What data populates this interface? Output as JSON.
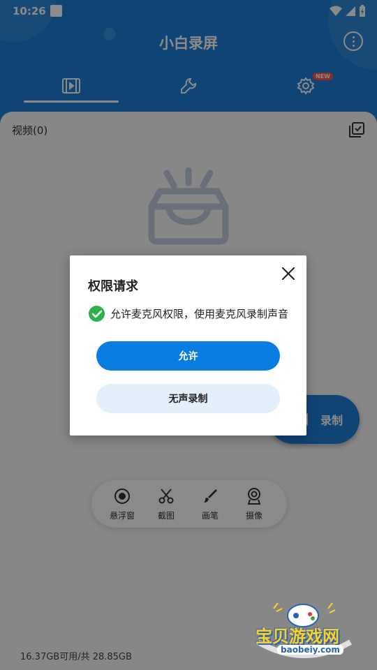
{
  "status_bar": {
    "time": "10:26"
  },
  "app": {
    "title": "小白录屏"
  },
  "tabs": {
    "settings_badge": "NEW"
  },
  "content": {
    "video_count_label": "视频(0)",
    "storage_info": "16.37GB可用/共 28.85GB"
  },
  "record_button": {
    "label": "录制"
  },
  "toolbar": {
    "items": [
      {
        "label": "悬浮窗",
        "icon": "floating-window-icon"
      },
      {
        "label": "截图",
        "icon": "scissors-icon"
      },
      {
        "label": "画笔",
        "icon": "brush-icon"
      },
      {
        "label": "摄像",
        "icon": "camera-icon"
      }
    ]
  },
  "dialog": {
    "title": "权限请求",
    "permission_text": "允许麦克风权限，使用麦克风录制声音",
    "allow_label": "允许",
    "silent_label": "无声录制"
  },
  "watermark": {
    "text": "宝贝游戏网",
    "url": "baobeiy.com"
  },
  "colors": {
    "primary": "#1e7fd8",
    "allow_button": "#0a7de3",
    "check_green": "#2db14b"
  }
}
